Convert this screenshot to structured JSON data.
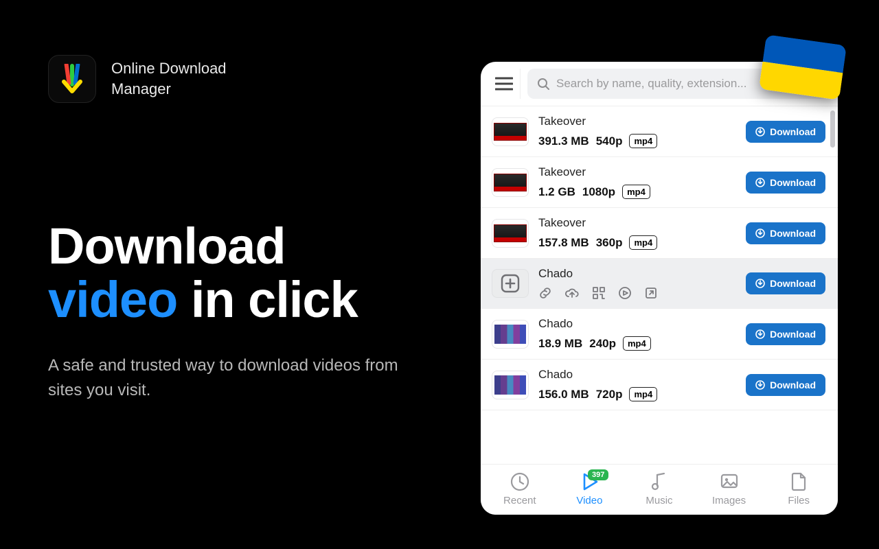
{
  "brand": {
    "line1": "Online Download",
    "line2": "Manager"
  },
  "headline": {
    "line1": "Download",
    "accent": "video",
    "rest": " in click"
  },
  "subhead": "A safe and trusted way to download videos from sites you visit.",
  "search": {
    "placeholder": "Search by name, quality, extension..."
  },
  "rows": [
    {
      "title": "Takeover",
      "size": "391.3 MB",
      "quality": "540p",
      "ext": "mp4",
      "thumb": "takeover"
    },
    {
      "title": "Takeover",
      "size": "1.2 GB",
      "quality": "1080p",
      "ext": "mp4",
      "thumb": "takeover"
    },
    {
      "title": "Takeover",
      "size": "157.8 MB",
      "quality": "360p",
      "ext": "mp4",
      "thumb": "takeover"
    },
    {
      "title": "Chado",
      "selected": true,
      "thumb": "plus"
    },
    {
      "title": "Chado",
      "size": "18.9 MB",
      "quality": "240p",
      "ext": "mp4",
      "thumb": "chado"
    },
    {
      "title": "Chado",
      "size": "156.0 MB",
      "quality": "720p",
      "ext": "mp4",
      "thumb": "chado"
    }
  ],
  "download_label": "Download",
  "nav": {
    "recent": "Recent",
    "video": "Video",
    "music": "Music",
    "images": "Images",
    "files": "Files",
    "video_badge": "397"
  }
}
